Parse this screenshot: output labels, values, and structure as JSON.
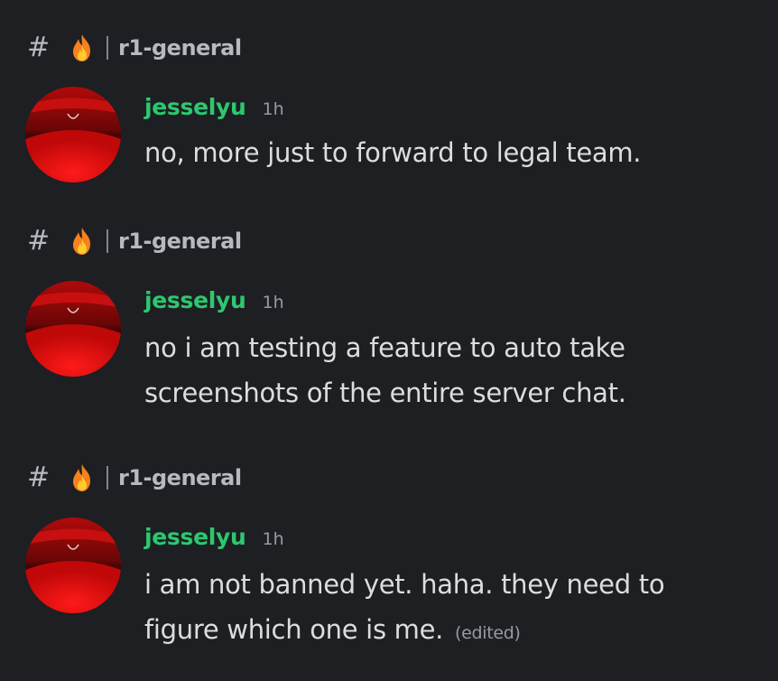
{
  "messages": [
    {
      "channel": "r1-general",
      "username": "jesselyu",
      "timestamp": "1h",
      "lines": [
        "no, more just to forward to legal team."
      ],
      "edited": ""
    },
    {
      "channel": "r1-general",
      "username": "jesselyu",
      "timestamp": "1h",
      "lines": [
        "no i am testing a feature to auto take",
        "screenshots of the entire server chat."
      ],
      "edited": ""
    },
    {
      "channel": "r1-general",
      "username": "jesselyu",
      "timestamp": "1h",
      "lines": [
        "i am not banned yet. haha. they need to",
        "figure which one is me."
      ],
      "edited": "(edited)"
    }
  ],
  "icons": {
    "channel": "hash-icon",
    "emoji": "fire-icon",
    "avatar": "avatar"
  },
  "colors": {
    "background": "#1e1f22",
    "username": "#2dc770",
    "text": "#dbdee1",
    "muted": "#949ba4",
    "avatar_red": "#e01010"
  }
}
